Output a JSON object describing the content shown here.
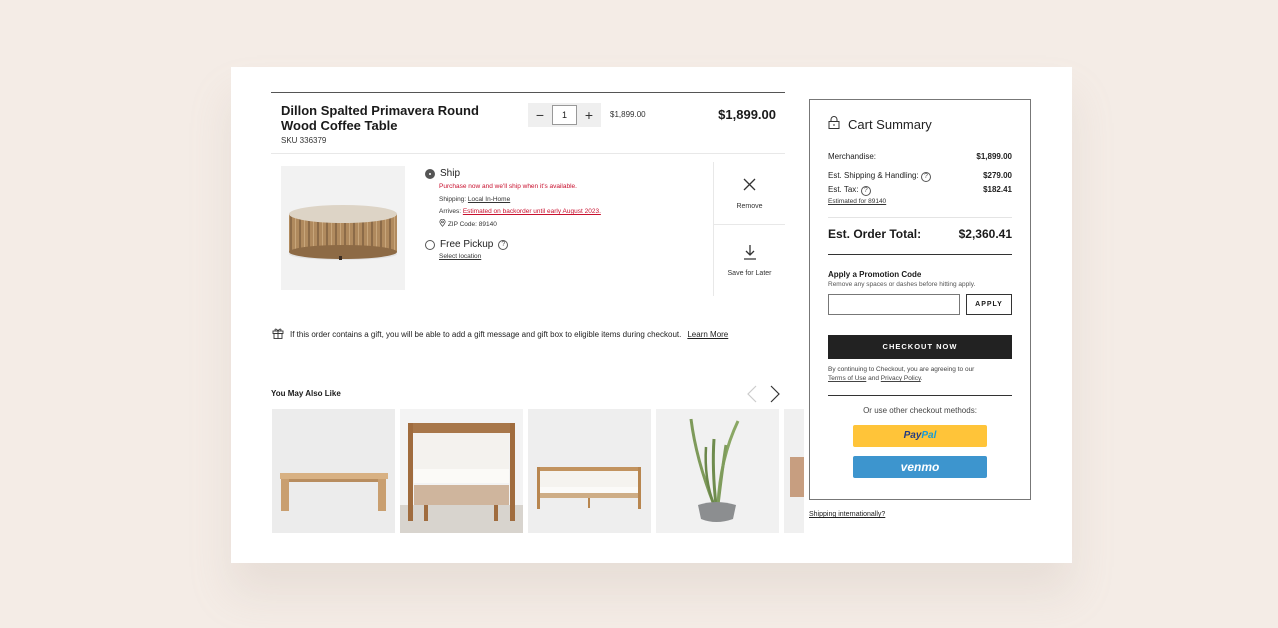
{
  "cart_item": {
    "title": "Dillon Spalted Primavera Round Wood Coffee Table",
    "sku": "SKU 336379",
    "quantity": "1",
    "qty_minus": "−",
    "qty_plus": "+",
    "unit_price": "$1,899.00",
    "line_total": "$1,899.00",
    "image_icon": "coffee-table-image",
    "ship_option": {
      "label": "Ship",
      "selected": true,
      "backorder_notice": "Purchase now and we'll ship when it's available.",
      "shipping_label": "Shipping:",
      "shipping_value": "Local In-Home",
      "arrives_label": "Arrives:",
      "arrives_value": "Estimated on backorder until early August 2023.",
      "zip_label": "ZIP Code: 89140"
    },
    "pickup_option": {
      "label": "Free Pickup",
      "selected": false,
      "select_location": "Select location"
    },
    "actions": {
      "remove": "Remove",
      "save_for_later": "Save for Later"
    }
  },
  "gift_notice": {
    "text": "If this order contains a gift, you will be able to add a gift message and gift box to eligible items during checkout.",
    "link": "Learn More"
  },
  "recommendations": {
    "title": "You May Also Like",
    "items": [
      {
        "name": "wood-bench"
      },
      {
        "name": "cane-lounge-chair"
      },
      {
        "name": "cane-sofa"
      },
      {
        "name": "potted-aloe-plant"
      },
      {
        "name": "leather-chair-partial"
      }
    ]
  },
  "summary": {
    "title": "Cart Summary",
    "merchandise_label": "Merchandise:",
    "merchandise_value": "$1,899.00",
    "shipping_label": "Est. Shipping & Handling:",
    "shipping_value": "$279.00",
    "tax_label": "Est. Tax:",
    "tax_value": "$182.41",
    "tax_estimate_link": "Estimated for 89140",
    "total_label": "Est. Order Total:",
    "total_value": "$2,360.41",
    "promo_title": "Apply a Promotion Code",
    "promo_hint": "Remove any spaces or dashes before hitting apply.",
    "promo_value": "",
    "apply_label": "APPLY",
    "checkout_label": "CHECKOUT NOW",
    "legal_prefix": "By continuing to Checkout, you are agreeing to our",
    "terms_link": "Terms of Use",
    "legal_and": "and",
    "privacy_link": "Privacy Policy",
    "other_methods": "Or use other checkout methods:",
    "paypal_1": "Pay",
    "paypal_2": "Pal",
    "venmo": "venmo"
  },
  "shipping_intl_link": "Shipping internationally?",
  "colors": {
    "background": "#f4ece6",
    "alert_red": "#c8102e",
    "paypal_yellow": "#ffc439",
    "venmo_blue": "#3d95ce",
    "checkout_black": "#222222"
  }
}
